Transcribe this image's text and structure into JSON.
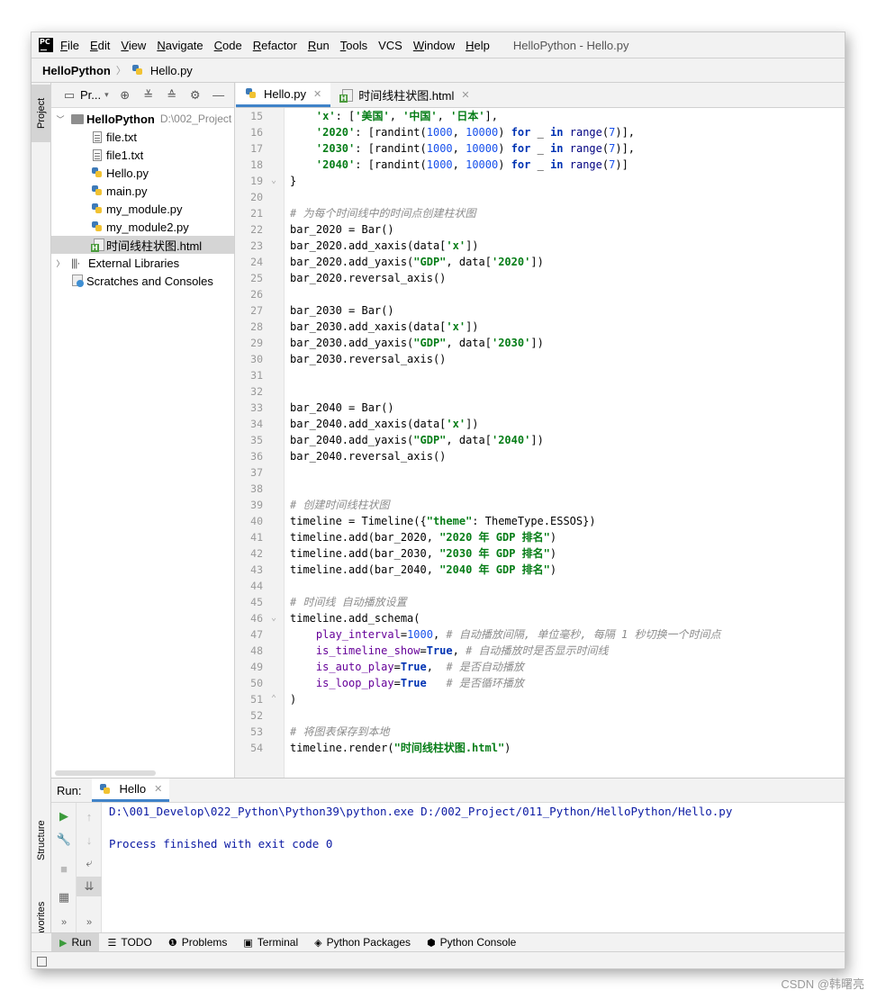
{
  "menubar": {
    "logo": "PC",
    "items": [
      {
        "u": "F",
        "rest": "ile"
      },
      {
        "u": "E",
        "rest": "dit"
      },
      {
        "u": "V",
        "rest": "iew"
      },
      {
        "u": "N",
        "rest": "avigate"
      },
      {
        "u": "C",
        "rest": "ode"
      },
      {
        "u": "R",
        "rest": "efactor"
      },
      {
        "u": "R",
        "rest": "un"
      },
      {
        "u": "T",
        "rest": "ools"
      },
      {
        "u": "",
        "rest": "VCS"
      },
      {
        "u": "W",
        "rest": "indow"
      },
      {
        "u": "H",
        "rest": "elp"
      }
    ],
    "window_title": "HelloPython - Hello.py"
  },
  "navbar": {
    "root": "HelloPython",
    "separator": "〉",
    "file": "Hello.py"
  },
  "left_stripe": {
    "project": "Project",
    "structure": "Structure",
    "favorites": "Favorites"
  },
  "project_panel": {
    "title": "Pr...",
    "tree": [
      {
        "label": "HelloPython",
        "hint": "D:\\002_Project",
        "icon": "folder",
        "bold": true,
        "arrow": "﹀",
        "indent": 0
      },
      {
        "label": "file.txt",
        "icon": "txt",
        "indent": 1
      },
      {
        "label": "file1.txt",
        "icon": "txt",
        "indent": 1
      },
      {
        "label": "Hello.py",
        "icon": "py",
        "indent": 1
      },
      {
        "label": "main.py",
        "icon": "py",
        "indent": 1
      },
      {
        "label": "my_module.py",
        "icon": "py",
        "indent": 1
      },
      {
        "label": "my_module2.py",
        "icon": "py",
        "indent": 1
      },
      {
        "label": "时间线柱状图.html",
        "icon": "html",
        "indent": 1,
        "selected": true
      },
      {
        "label": "External Libraries",
        "icon": "lib",
        "arrow": "〉",
        "indent": 0
      },
      {
        "label": "Scratches and Consoles",
        "icon": "scratch",
        "indent": 0
      }
    ]
  },
  "editor": {
    "tabs": [
      {
        "label": "Hello.py",
        "icon": "py",
        "active": true
      },
      {
        "label": "时间线柱状图.html",
        "icon": "html",
        "active": false
      }
    ],
    "close_glyph": "✕",
    "lines": [
      {
        "n": "15",
        "seg": [
          [
            "",
            "    "
          ],
          [
            "s-str",
            "'x'"
          ],
          [
            "",
            ": ["
          ],
          [
            "s-str",
            "'美国'"
          ],
          [
            "",
            ", "
          ],
          [
            "s-str",
            "'中国'"
          ],
          [
            "",
            ", "
          ],
          [
            "s-str",
            "'日本'"
          ],
          [
            "",
            "],"
          ]
        ]
      },
      {
        "n": "16",
        "seg": [
          [
            "",
            "    "
          ],
          [
            "s-str",
            "'2020'"
          ],
          [
            "",
            ": [randint("
          ],
          [
            "s-num",
            "1000"
          ],
          [
            "",
            ", "
          ],
          [
            "s-num",
            "10000"
          ],
          [
            "",
            ") "
          ],
          [
            "s-kw",
            "for"
          ],
          [
            "",
            " _ "
          ],
          [
            "s-kw",
            "in"
          ],
          [
            "",
            " "
          ],
          [
            "s-fn",
            "range"
          ],
          [
            "",
            "("
          ],
          [
            "s-num",
            "7"
          ],
          [
            "",
            ")],"
          ]
        ]
      },
      {
        "n": "17",
        "seg": [
          [
            "",
            "    "
          ],
          [
            "s-str",
            "'2030'"
          ],
          [
            "",
            ": [randint("
          ],
          [
            "s-num",
            "1000"
          ],
          [
            "",
            ", "
          ],
          [
            "s-num",
            "10000"
          ],
          [
            "",
            ") "
          ],
          [
            "s-kw",
            "for"
          ],
          [
            "",
            " _ "
          ],
          [
            "s-kw",
            "in"
          ],
          [
            "",
            " "
          ],
          [
            "s-fn",
            "range"
          ],
          [
            "",
            "("
          ],
          [
            "s-num",
            "7"
          ],
          [
            "",
            ")],"
          ]
        ]
      },
      {
        "n": "18",
        "seg": [
          [
            "",
            "    "
          ],
          [
            "s-str",
            "'2040'"
          ],
          [
            "",
            ": [randint("
          ],
          [
            "s-num",
            "1000"
          ],
          [
            "",
            ", "
          ],
          [
            "s-num",
            "10000"
          ],
          [
            "",
            ") "
          ],
          [
            "s-kw",
            "for"
          ],
          [
            "",
            " _ "
          ],
          [
            "s-kw",
            "in"
          ],
          [
            "",
            " "
          ],
          [
            "s-fn",
            "range"
          ],
          [
            "",
            "("
          ],
          [
            "s-num",
            "7"
          ],
          [
            "",
            ")]"
          ]
        ],
        "fold": ""
      },
      {
        "n": "19",
        "seg": [
          [
            "",
            "}"
          ]
        ],
        "fold": "⌄"
      },
      {
        "n": "20",
        "seg": []
      },
      {
        "n": "21",
        "seg": [
          [
            "s-com",
            "# 为每个时间线中的时间点创建柱状图"
          ]
        ]
      },
      {
        "n": "22",
        "seg": [
          [
            "",
            "bar_2020 = Bar()"
          ]
        ]
      },
      {
        "n": "23",
        "seg": [
          [
            "",
            "bar_2020.add_xaxis(data["
          ],
          [
            "s-str",
            "'x'"
          ],
          [
            "",
            "])"
          ]
        ]
      },
      {
        "n": "24",
        "seg": [
          [
            "",
            "bar_2020.add_yaxis("
          ],
          [
            "s-str",
            "\"GDP\""
          ],
          [
            "",
            ", data["
          ],
          [
            "s-str",
            "'2020'"
          ],
          [
            "",
            "])"
          ]
        ]
      },
      {
        "n": "25",
        "seg": [
          [
            "",
            "bar_2020.reversal_axis()"
          ]
        ]
      },
      {
        "n": "26",
        "seg": []
      },
      {
        "n": "27",
        "seg": [
          [
            "",
            "bar_2030 = Bar()"
          ]
        ]
      },
      {
        "n": "28",
        "seg": [
          [
            "",
            "bar_2030.add_xaxis(data["
          ],
          [
            "s-str",
            "'x'"
          ],
          [
            "",
            "])"
          ]
        ]
      },
      {
        "n": "29",
        "seg": [
          [
            "",
            "bar_2030.add_yaxis("
          ],
          [
            "s-str",
            "\"GDP\""
          ],
          [
            "",
            ", data["
          ],
          [
            "s-str",
            "'2030'"
          ],
          [
            "",
            "])"
          ]
        ]
      },
      {
        "n": "30",
        "seg": [
          [
            "",
            "bar_2030.reversal_axis()"
          ]
        ]
      },
      {
        "n": "31",
        "seg": []
      },
      {
        "n": "32",
        "seg": []
      },
      {
        "n": "33",
        "seg": [
          [
            "",
            "bar_2040 = Bar()"
          ]
        ]
      },
      {
        "n": "34",
        "seg": [
          [
            "",
            "bar_2040.add_xaxis(data["
          ],
          [
            "s-str",
            "'x'"
          ],
          [
            "",
            "])"
          ]
        ]
      },
      {
        "n": "35",
        "seg": [
          [
            "",
            "bar_2040.add_yaxis("
          ],
          [
            "s-str",
            "\"GDP\""
          ],
          [
            "",
            ", data["
          ],
          [
            "s-str",
            "'2040'"
          ],
          [
            "",
            "])"
          ]
        ]
      },
      {
        "n": "36",
        "seg": [
          [
            "",
            "bar_2040.reversal_axis()"
          ]
        ]
      },
      {
        "n": "37",
        "seg": []
      },
      {
        "n": "38",
        "seg": []
      },
      {
        "n": "39",
        "seg": [
          [
            "s-com",
            "# 创建时间线柱状图"
          ]
        ]
      },
      {
        "n": "40",
        "seg": [
          [
            "",
            "timeline = Timeline({"
          ],
          [
            "s-str",
            "\"theme\""
          ],
          [
            "",
            ": ThemeType.ESSOS})"
          ]
        ]
      },
      {
        "n": "41",
        "seg": [
          [
            "",
            "timeline.add(bar_2020, "
          ],
          [
            "s-str",
            "\"2020 年 GDP 排名\""
          ],
          [
            "",
            ")"
          ]
        ]
      },
      {
        "n": "42",
        "seg": [
          [
            "",
            "timeline.add(bar_2030, "
          ],
          [
            "s-str",
            "\"2030 年 GDP 排名\""
          ],
          [
            "",
            ")"
          ]
        ]
      },
      {
        "n": "43",
        "seg": [
          [
            "",
            "timeline.add(bar_2040, "
          ],
          [
            "s-str",
            "\"2040 年 GDP 排名\""
          ],
          [
            "",
            ")"
          ]
        ]
      },
      {
        "n": "44",
        "seg": []
      },
      {
        "n": "45",
        "seg": [
          [
            "s-com",
            "# 时间线 自动播放设置"
          ]
        ]
      },
      {
        "n": "46",
        "seg": [
          [
            "",
            "timeline.add_schema("
          ]
        ],
        "fold": "⌄"
      },
      {
        "n": "47",
        "seg": [
          [
            "",
            "    "
          ],
          [
            "s-arg",
            "play_interval"
          ],
          [
            "",
            "="
          ],
          [
            "s-num",
            "1000"
          ],
          [
            "",
            ", "
          ],
          [
            "s-com",
            "# 自动播放间隔, 单位毫秒, 每隔 1 秒切换一个时间点"
          ]
        ]
      },
      {
        "n": "48",
        "seg": [
          [
            "",
            "    "
          ],
          [
            "s-arg",
            "is_timeline_show"
          ],
          [
            "",
            "="
          ],
          [
            "s-kw",
            "True"
          ],
          [
            "",
            ", "
          ],
          [
            "s-com",
            "# 自动播放时是否显示时间线"
          ]
        ]
      },
      {
        "n": "49",
        "seg": [
          [
            "",
            "    "
          ],
          [
            "s-arg",
            "is_auto_play"
          ],
          [
            "",
            "="
          ],
          [
            "s-kw",
            "True"
          ],
          [
            "",
            ",  "
          ],
          [
            "s-com",
            "# 是否自动播放"
          ]
        ]
      },
      {
        "n": "50",
        "seg": [
          [
            "",
            "    "
          ],
          [
            "s-arg",
            "is_loop_play"
          ],
          [
            "",
            "="
          ],
          [
            "s-kw",
            "True"
          ],
          [
            "",
            "   "
          ],
          [
            "s-com",
            "# 是否循环播放"
          ]
        ]
      },
      {
        "n": "51",
        "seg": [
          [
            "",
            ")"
          ]
        ],
        "fold": "⌃"
      },
      {
        "n": "52",
        "seg": []
      },
      {
        "n": "53",
        "seg": [
          [
            "s-com",
            "# 将图表保存到本地"
          ]
        ]
      },
      {
        "n": "54",
        "seg": [
          [
            "",
            "timeline.render("
          ],
          [
            "s-str",
            "\"时间线柱状图.html\""
          ],
          [
            "",
            ")"
          ]
        ]
      }
    ]
  },
  "run_panel": {
    "label": "Run:",
    "tab": "Hello",
    "console": [
      "D:\\001_Develop\\022_Python\\Python39\\python.exe D:/002_Project/011_Python/HelloPython/Hello.py",
      "",
      "Process finished with exit code 0"
    ]
  },
  "bottom_bar": [
    {
      "label": "Run",
      "icon": "▶",
      "active": true
    },
    {
      "label": "TODO",
      "icon": "☰"
    },
    {
      "label": "Problems",
      "icon": "❶"
    },
    {
      "label": "Terminal",
      "icon": "▣"
    },
    {
      "label": "Python Packages",
      "icon": "◈"
    },
    {
      "label": "Python Console",
      "icon": "⬢"
    }
  ],
  "watermark": "CSDN @韩曙亮",
  "colors": {
    "accent": "#4083c9",
    "string": "#067d17",
    "keyword": "#0033b3",
    "number": "#1750eb",
    "comment": "#8c8c8c",
    "console": "#0b1aa3"
  }
}
